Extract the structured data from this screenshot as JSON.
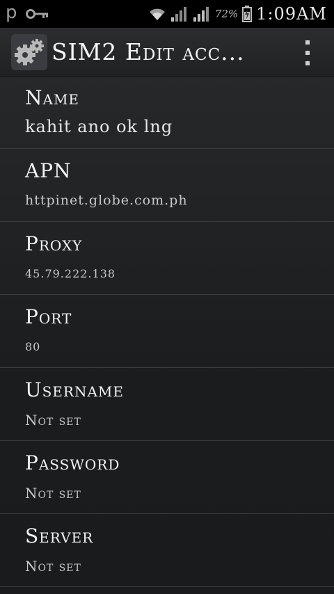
{
  "status_bar": {
    "left_letter": "p",
    "battery_percent": "72%",
    "time": "1:09AM",
    "icons": [
      "key-icon",
      "wifi-icon",
      "signal-icon",
      "signal-icon",
      "battery-icon"
    ]
  },
  "action_bar": {
    "title": "SIM2 Edit acc...",
    "app_icon": "gears-icon",
    "overflow_icon": "overflow-menu-icon"
  },
  "preferences": [
    {
      "title": "Name",
      "summary": "kahit ano ok lng"
    },
    {
      "title": "APN",
      "summary": "httpinet.globe.com.ph"
    },
    {
      "title": "Proxy",
      "summary": "45.79.222.138"
    },
    {
      "title": "Port",
      "summary": "80"
    },
    {
      "title": "Username",
      "summary": "Not set"
    },
    {
      "title": "Password",
      "summary": "Not set"
    },
    {
      "title": "Server",
      "summary": "Not set"
    }
  ],
  "colors": {
    "background": "#1c1d1f",
    "action_bar": "#26282a",
    "text": "#f4f4f4",
    "summary": "#c9c9c9",
    "divider": "#3a3c3e"
  }
}
